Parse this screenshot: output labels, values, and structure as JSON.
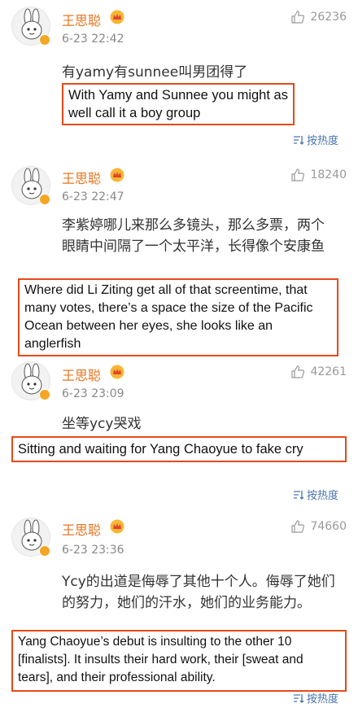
{
  "comments": [
    {
      "username": "王思聪",
      "time": "6-23 22:42",
      "likes": "26236",
      "text": "有yamy有sunnee叫男团得了",
      "translation": "With Yamy and Sunnee you might as well call it a boy group",
      "sort_label": "按热度"
    },
    {
      "username": "王思聪",
      "time": "6-23 22:47",
      "likes": "18240",
      "text": "李紫婷哪儿来那么多镜头，那么多票，两个眼睛中间隔了一个太平洋，长得像个安康鱼",
      "translation": "Where did Li Ziting get all of that screentime, that many votes, there’s a space the size of the Pacific Ocean between her eyes, she looks like an anglerfish"
    },
    {
      "username": "王思聪",
      "time": "6-23 23:09",
      "likes": "42261",
      "text": "坐等ycy哭戏",
      "translation": "Sitting and waiting for Yang Chaoyue to fake cry",
      "sort_label": "按热度"
    },
    {
      "username": "王思聪",
      "time": "6-23 23:36",
      "likes": "74660",
      "text": "Ycy的出道是侮辱了其他十个人。侮辱了她们的努力，她们的汗水，她们的业务能力。",
      "translation": "Yang Chaoyue’s debut is insulting to the other 10 [finalists]. It insults their hard work, their [sweat and tears], and their professional ability.",
      "sort_label": "按热度"
    }
  ],
  "colors": {
    "username": "#e8751f",
    "translation_border": "#e64a19",
    "sort_link": "#4a74b0"
  },
  "icons": [
    "avatar-rabbit",
    "verified-badge",
    "crown-icon",
    "thumbs-up-icon",
    "sort-icon"
  ]
}
